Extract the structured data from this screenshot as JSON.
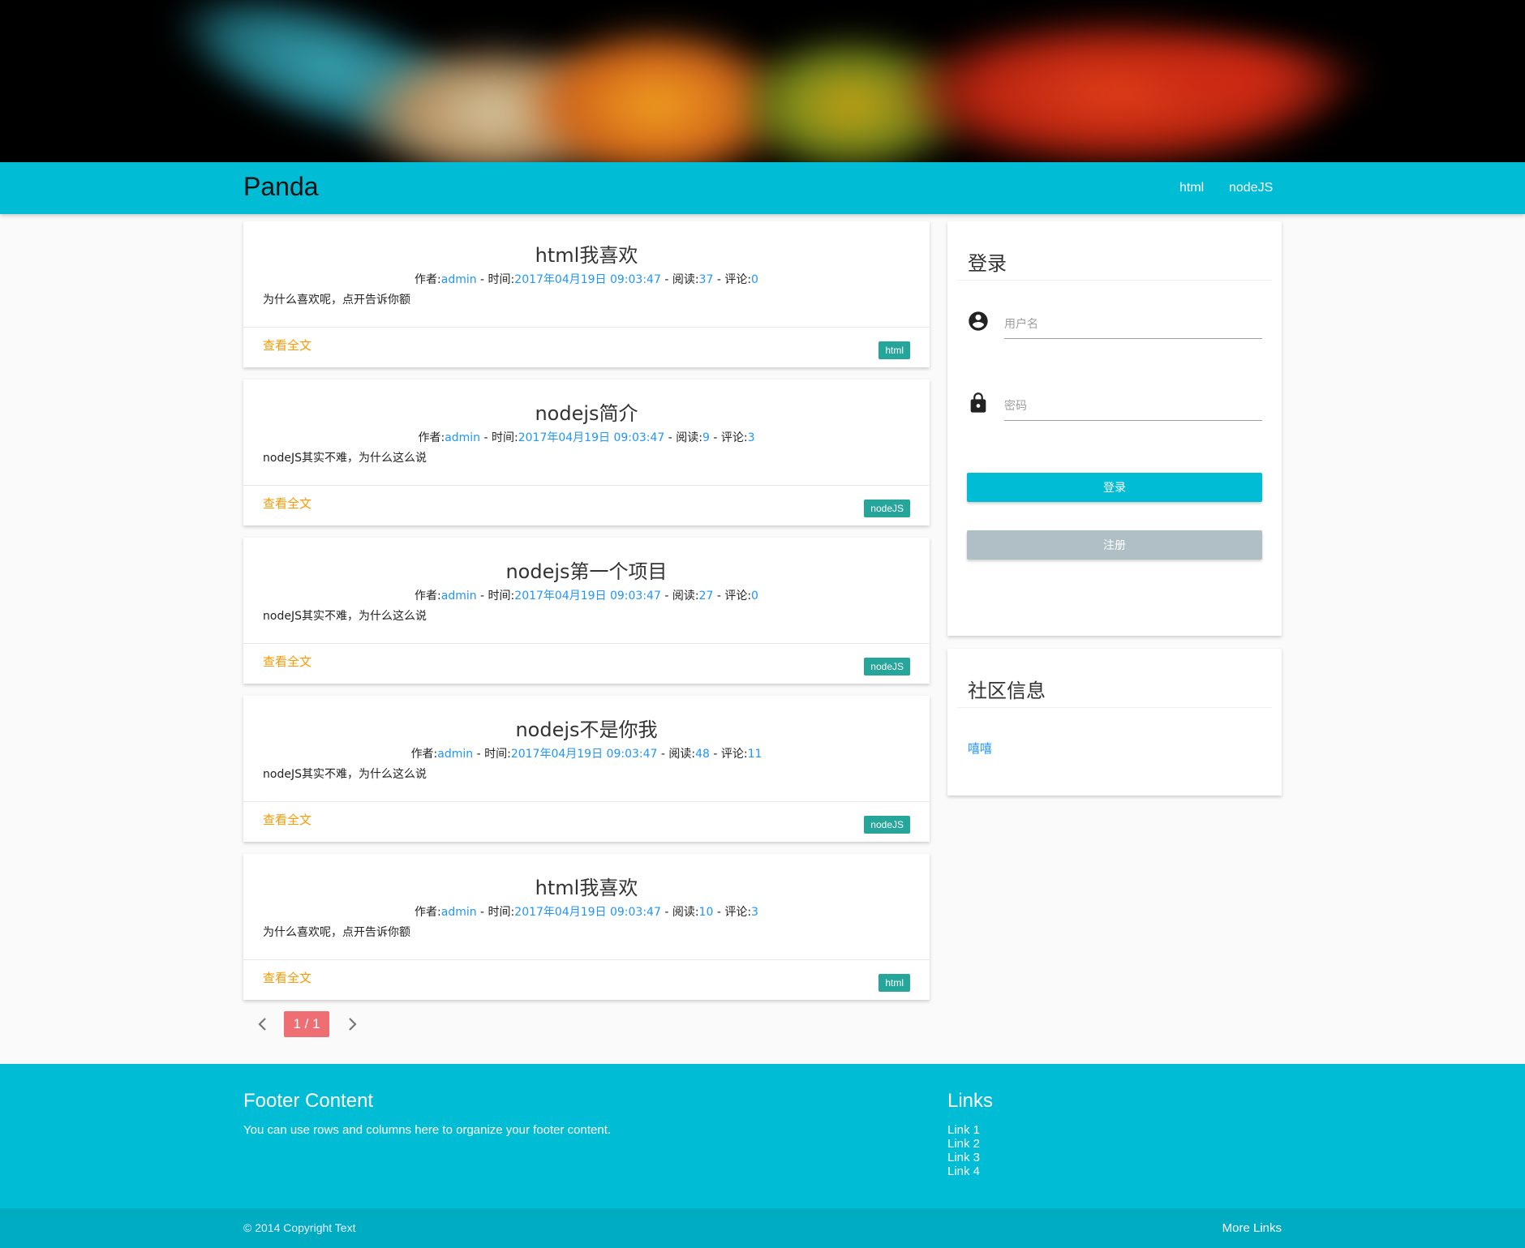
{
  "nav": {
    "brand": "Panda",
    "links": [
      {
        "label": "html"
      },
      {
        "label": "nodeJS"
      }
    ]
  },
  "posts": [
    {
      "title": "html我喜欢",
      "author_label": "作者:",
      "author": "admin",
      "time_label": " - 时间:",
      "time": "2017年04月19日 09:03:47",
      "read_label": " - 阅读:",
      "reads": "37",
      "comment_label": " - 评论:",
      "comments": "0",
      "summary": "为什么喜欢呢，点开告诉你额",
      "readmore": "查看全文",
      "tag": "html"
    },
    {
      "title": "nodejs简介",
      "author_label": "作者:",
      "author": "admin",
      "time_label": " - 时间:",
      "time": "2017年04月19日 09:03:47",
      "read_label": " - 阅读:",
      "reads": "9",
      "comment_label": " - 评论:",
      "comments": "3",
      "summary": "nodeJS其实不难，为什么这么说",
      "readmore": "查看全文",
      "tag": "nodeJS"
    },
    {
      "title": "nodejs第一个项目",
      "author_label": "作者:",
      "author": "admin",
      "time_label": " - 时间:",
      "time": "2017年04月19日 09:03:47",
      "read_label": " - 阅读:",
      "reads": "27",
      "comment_label": " - 评论:",
      "comments": "0",
      "summary": "nodeJS其实不难，为什么这么说",
      "readmore": "查看全文",
      "tag": "nodeJS"
    },
    {
      "title": "nodejs不是你我",
      "author_label": "作者:",
      "author": "admin",
      "time_label": " - 时间:",
      "time": "2017年04月19日 09:03:47",
      "read_label": " - 阅读:",
      "reads": "48",
      "comment_label": " - 评论:",
      "comments": "11",
      "summary": "nodeJS其实不难，为什么这么说",
      "readmore": "查看全文",
      "tag": "nodeJS"
    },
    {
      "title": "html我喜欢",
      "author_label": "作者:",
      "author": "admin",
      "time_label": " - 时间:",
      "time": "2017年04月19日 09:03:47",
      "read_label": " - 阅读:",
      "reads": "10",
      "comment_label": " - 评论:",
      "comments": "3",
      "summary": "为什么喜欢呢，点开告诉你额",
      "readmore": "查看全文",
      "tag": "html"
    }
  ],
  "pagination": {
    "current": "1 / 1",
    "prev_icon": "chevron-left-icon",
    "next_icon": "chevron-right-icon"
  },
  "login": {
    "title": "登录",
    "username_placeholder": "用户名",
    "password_placeholder": "密码",
    "login_button": "登录",
    "register_button": "注册",
    "username_icon": "account-circle-icon",
    "password_icon": "lock-icon"
  },
  "community": {
    "title": "社区信息",
    "link": "嘻嘻"
  },
  "footer": {
    "title": "Footer Content",
    "text": "You can use rows and columns here to organize your footer content.",
    "links_title": "Links",
    "links": [
      "Link 1",
      "Link 2",
      "Link 3",
      "Link 4"
    ],
    "copyright": "© 2014 Copyright Text",
    "more_links": "More Links"
  },
  "colors": {
    "primary": "#00bcd4",
    "accent_link": "#2196f3",
    "readmore": "#ff9800",
    "tag": "#26a69a",
    "pager_active": "#ee6e73",
    "register_button": "#b0bec5"
  }
}
